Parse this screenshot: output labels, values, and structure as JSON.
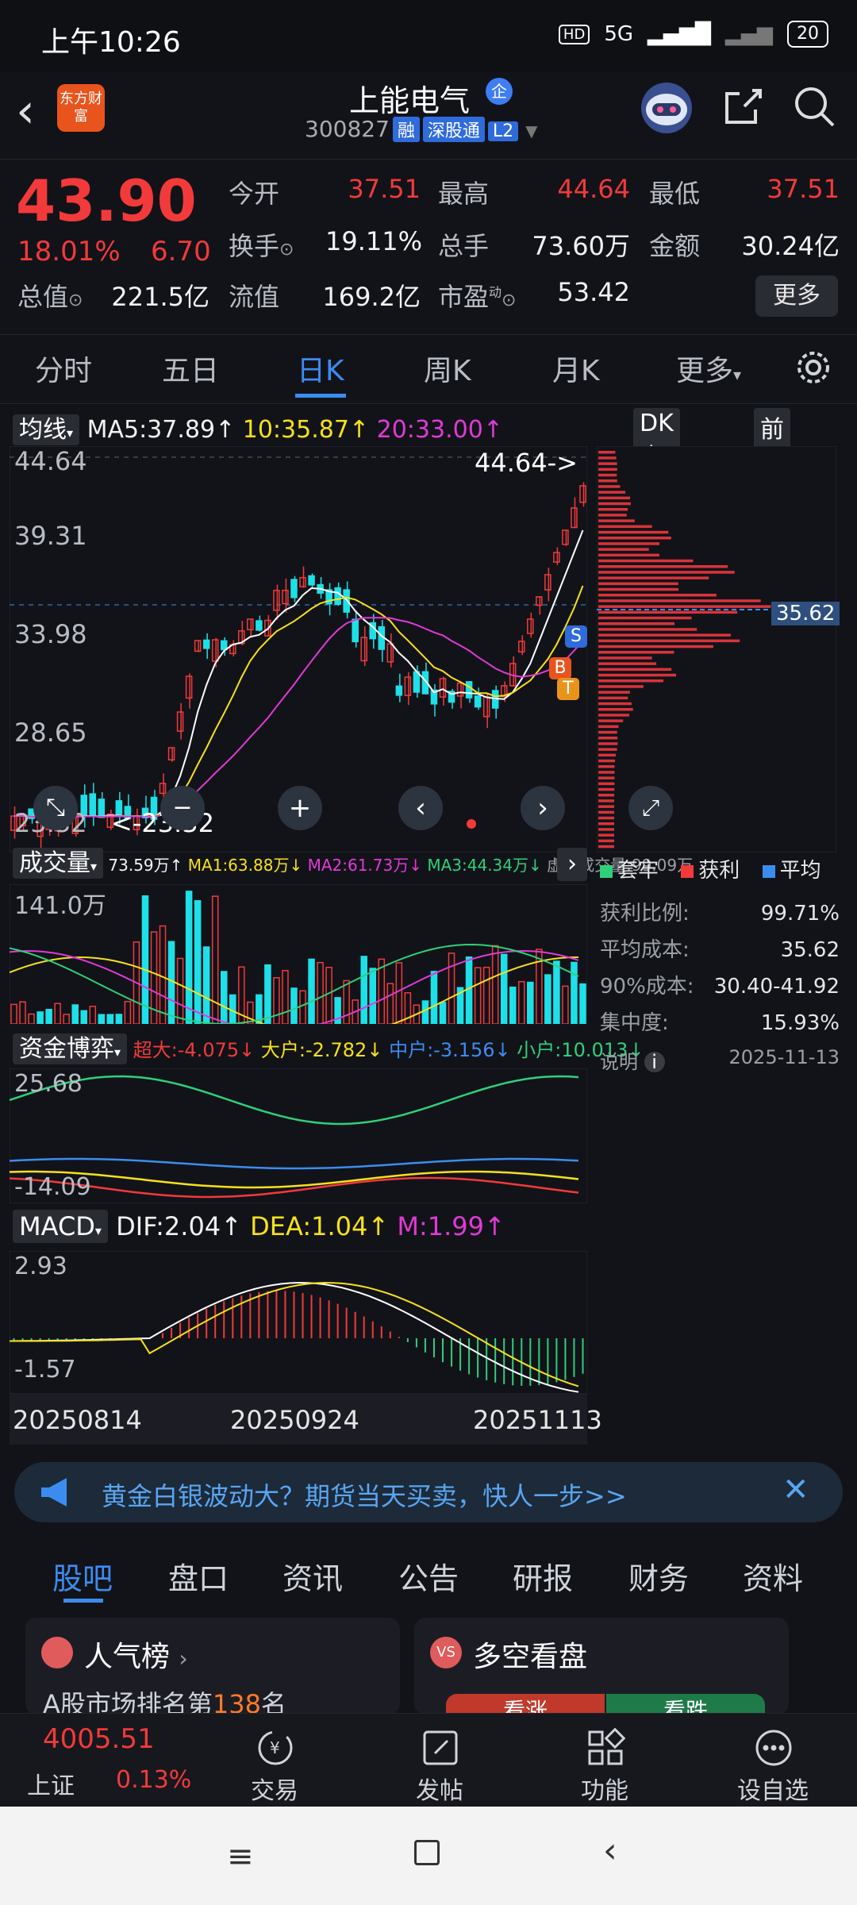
{
  "status_bar": {
    "time": "上午10:26",
    "network": "5G",
    "battery": "20"
  },
  "header": {
    "app_logo_text": "东方财富",
    "stock_name": "上能电气",
    "qi_badge": "企",
    "stock_code": "300827",
    "tags": [
      "融",
      "深股通",
      "L2"
    ]
  },
  "quote": {
    "price": "43.90",
    "change_pct": "18.01%",
    "change_amt": "6.70",
    "rows": [
      [
        {
          "label": "今开",
          "value": "37.51"
        },
        {
          "label": "最高",
          "value": "44.64"
        },
        {
          "label": "最低",
          "value": "37.51"
        }
      ],
      [
        {
          "label": "换手",
          "value": "19.11%"
        },
        {
          "label": "总手",
          "value": "73.60万"
        },
        {
          "label": "金额",
          "value": "30.24亿"
        }
      ],
      [
        {
          "label": "总值",
          "value": "221.5亿"
        },
        {
          "label": "流值",
          "value": "169.2亿"
        },
        {
          "label": "市盈",
          "value": "53.42"
        }
      ]
    ],
    "more_label": "更多",
    "pe_superscript": "动"
  },
  "periods": {
    "tabs": [
      "分时",
      "五日",
      "日K",
      "周K",
      "月K",
      "更多"
    ],
    "active": "日K"
  },
  "kline": {
    "indicator_label": "均线",
    "ma5": "MA5:37.89",
    "ma10": "10:35.87",
    "ma20": "20:33.00",
    "dk_label": "DK点",
    "adjust_label": "前复权",
    "y_ticks": [
      "44.64",
      "39.31",
      "33.98",
      "28.65",
      "23.32"
    ],
    "high_marker": "44.64->",
    "low_marker": "<-23.32",
    "signal_labels": [
      "S",
      "B",
      "T"
    ]
  },
  "volume": {
    "label": "成交量",
    "summary": "73.59万",
    "ma1": "MA1:63.88万",
    "ma2": "MA2:61.73万",
    "ma3": "MA3:44.34万",
    "virtual": "虚拟成交量:99.09万",
    "y_tick": "141.0万"
  },
  "capital": {
    "label": "资金博弈",
    "super": "超大:-4.075",
    "large": "大户:-2.782",
    "mid": "中户:-3.156",
    "small": "小户:10.013",
    "y_ticks": [
      "25.68",
      "-14.09"
    ]
  },
  "macd": {
    "label": "MACD",
    "dif": "DIF:2.04",
    "dea": "DEA:1.04",
    "m": "M:1.99",
    "y_ticks": [
      "2.93",
      "-1.57"
    ],
    "dates": [
      "20250814",
      "20250924",
      "20251113"
    ]
  },
  "chip": {
    "cost_marker": "35.62",
    "legend": [
      "套牢",
      "获利",
      "平均"
    ],
    "stats": [
      {
        "label": "获利比例:",
        "value": "99.71%"
      },
      {
        "label": "平均成本:",
        "value": "35.62"
      },
      {
        "label": "90%成本:",
        "value": "30.40-41.92"
      },
      {
        "label": "集中度:",
        "value": "15.93%"
      }
    ],
    "note_label": "说明",
    "date": "2025-11-13"
  },
  "banner": {
    "text": "黄金白银波动大？期货当天买卖，快人一步>>"
  },
  "news_tabs": [
    "股吧",
    "盘口",
    "资讯",
    "公告",
    "研报",
    "财务",
    "资料"
  ],
  "cards": {
    "popular_title": "人气榜",
    "popular_text_prefix": "A股市场排名第",
    "popular_rank": "138",
    "popular_text_suffix": "名",
    "vs_title": "多空看盘",
    "vs_up": "看涨",
    "vs_down": "看跌"
  },
  "bottom_nav": {
    "index_value": "4005.51",
    "index_name": "上证",
    "index_change": "0.13%",
    "items": [
      "交易",
      "发帖",
      "功能",
      "设自选"
    ]
  },
  "colors": {
    "up": "#f23a3a",
    "down": "#1ee0e8",
    "ma5": "#ffffff",
    "ma10": "#f7e11b",
    "ma20": "#e03ad6",
    "accent": "#3c8cf0"
  },
  "chart_data": {
    "type": "candlestick",
    "series": [
      {
        "name": "MA5",
        "value": "37.89"
      },
      {
        "name": "MA10",
        "value": "35.87"
      },
      {
        "name": "MA20",
        "value": "33.00"
      }
    ],
    "ylim": [
      23.32,
      44.64
    ]
  }
}
